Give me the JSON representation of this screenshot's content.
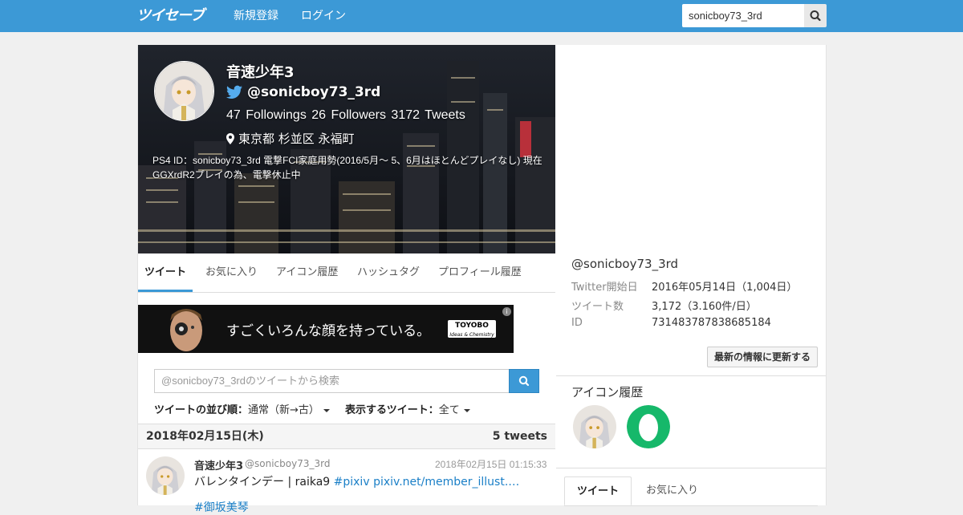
{
  "nav": {
    "logo": "ツイセーブ",
    "links": [
      "新規登録",
      "ログイン"
    ],
    "search_value": "sonicboy73_3rd"
  },
  "profile": {
    "name": "音速少年3",
    "handle": "@sonicboy73_3rd",
    "stats": "47 Followings  26 Followers  3172 Tweets",
    "location": "東京都 杉並区 永福町",
    "bio": "PS4 ID：sonicboy73_3rd 電撃FCI家庭用勢(2016/5月～ 5、6月はほとんどプレイなし) 現在GGXrdR2プレイの為、電撃休止中"
  },
  "tabs": [
    "ツイート",
    "お気に入り",
    "アイコン履歴",
    "ハッシュタグ",
    "プロフィール履歴"
  ],
  "ad": {
    "text": "すごくいろんな顔を持っている。",
    "brand": "TOYOBO",
    "brand_sub": "Ideas & Chemistry"
  },
  "tweet_search": {
    "placeholder": "@sonicboy73_3rdのツイートから検索"
  },
  "sort": {
    "order_label": "ツイートの並び順：",
    "order_value": "通常（新→古）",
    "filter_label": "表示するツイート：",
    "filter_value": "全て"
  },
  "date_group": {
    "date": "2018年02月15日(木)",
    "count": "5 tweets"
  },
  "tweet": {
    "name": "音速少年3",
    "handle": "@sonicboy73_3rd",
    "time": "2018年02月15日 01:15:33",
    "text": "バレンタインデー | raika9 ",
    "link1": "#pixiv",
    "link2": "pixiv.net/member_illust.…",
    "more": "#御坂美琴"
  },
  "side": {
    "handle": "@sonicboy73_3rd",
    "rows": [
      {
        "k": "Twitter開始日",
        "v": "2016年05月14日（1,004日）"
      },
      {
        "k": "ツイート数",
        "v": "3,172（3.160件/日）"
      },
      {
        "k": "ID",
        "v": "731483787838685184"
      }
    ],
    "update_button": "最新の情報に更新する",
    "icon_history_title": "アイコン履歴",
    "tabs": [
      "ツイート",
      "お気に入り"
    ]
  },
  "colors": {
    "brand_blue": "#3c99d6",
    "link_blue": "#1a7fc7",
    "icon_green": "#16b86a"
  }
}
